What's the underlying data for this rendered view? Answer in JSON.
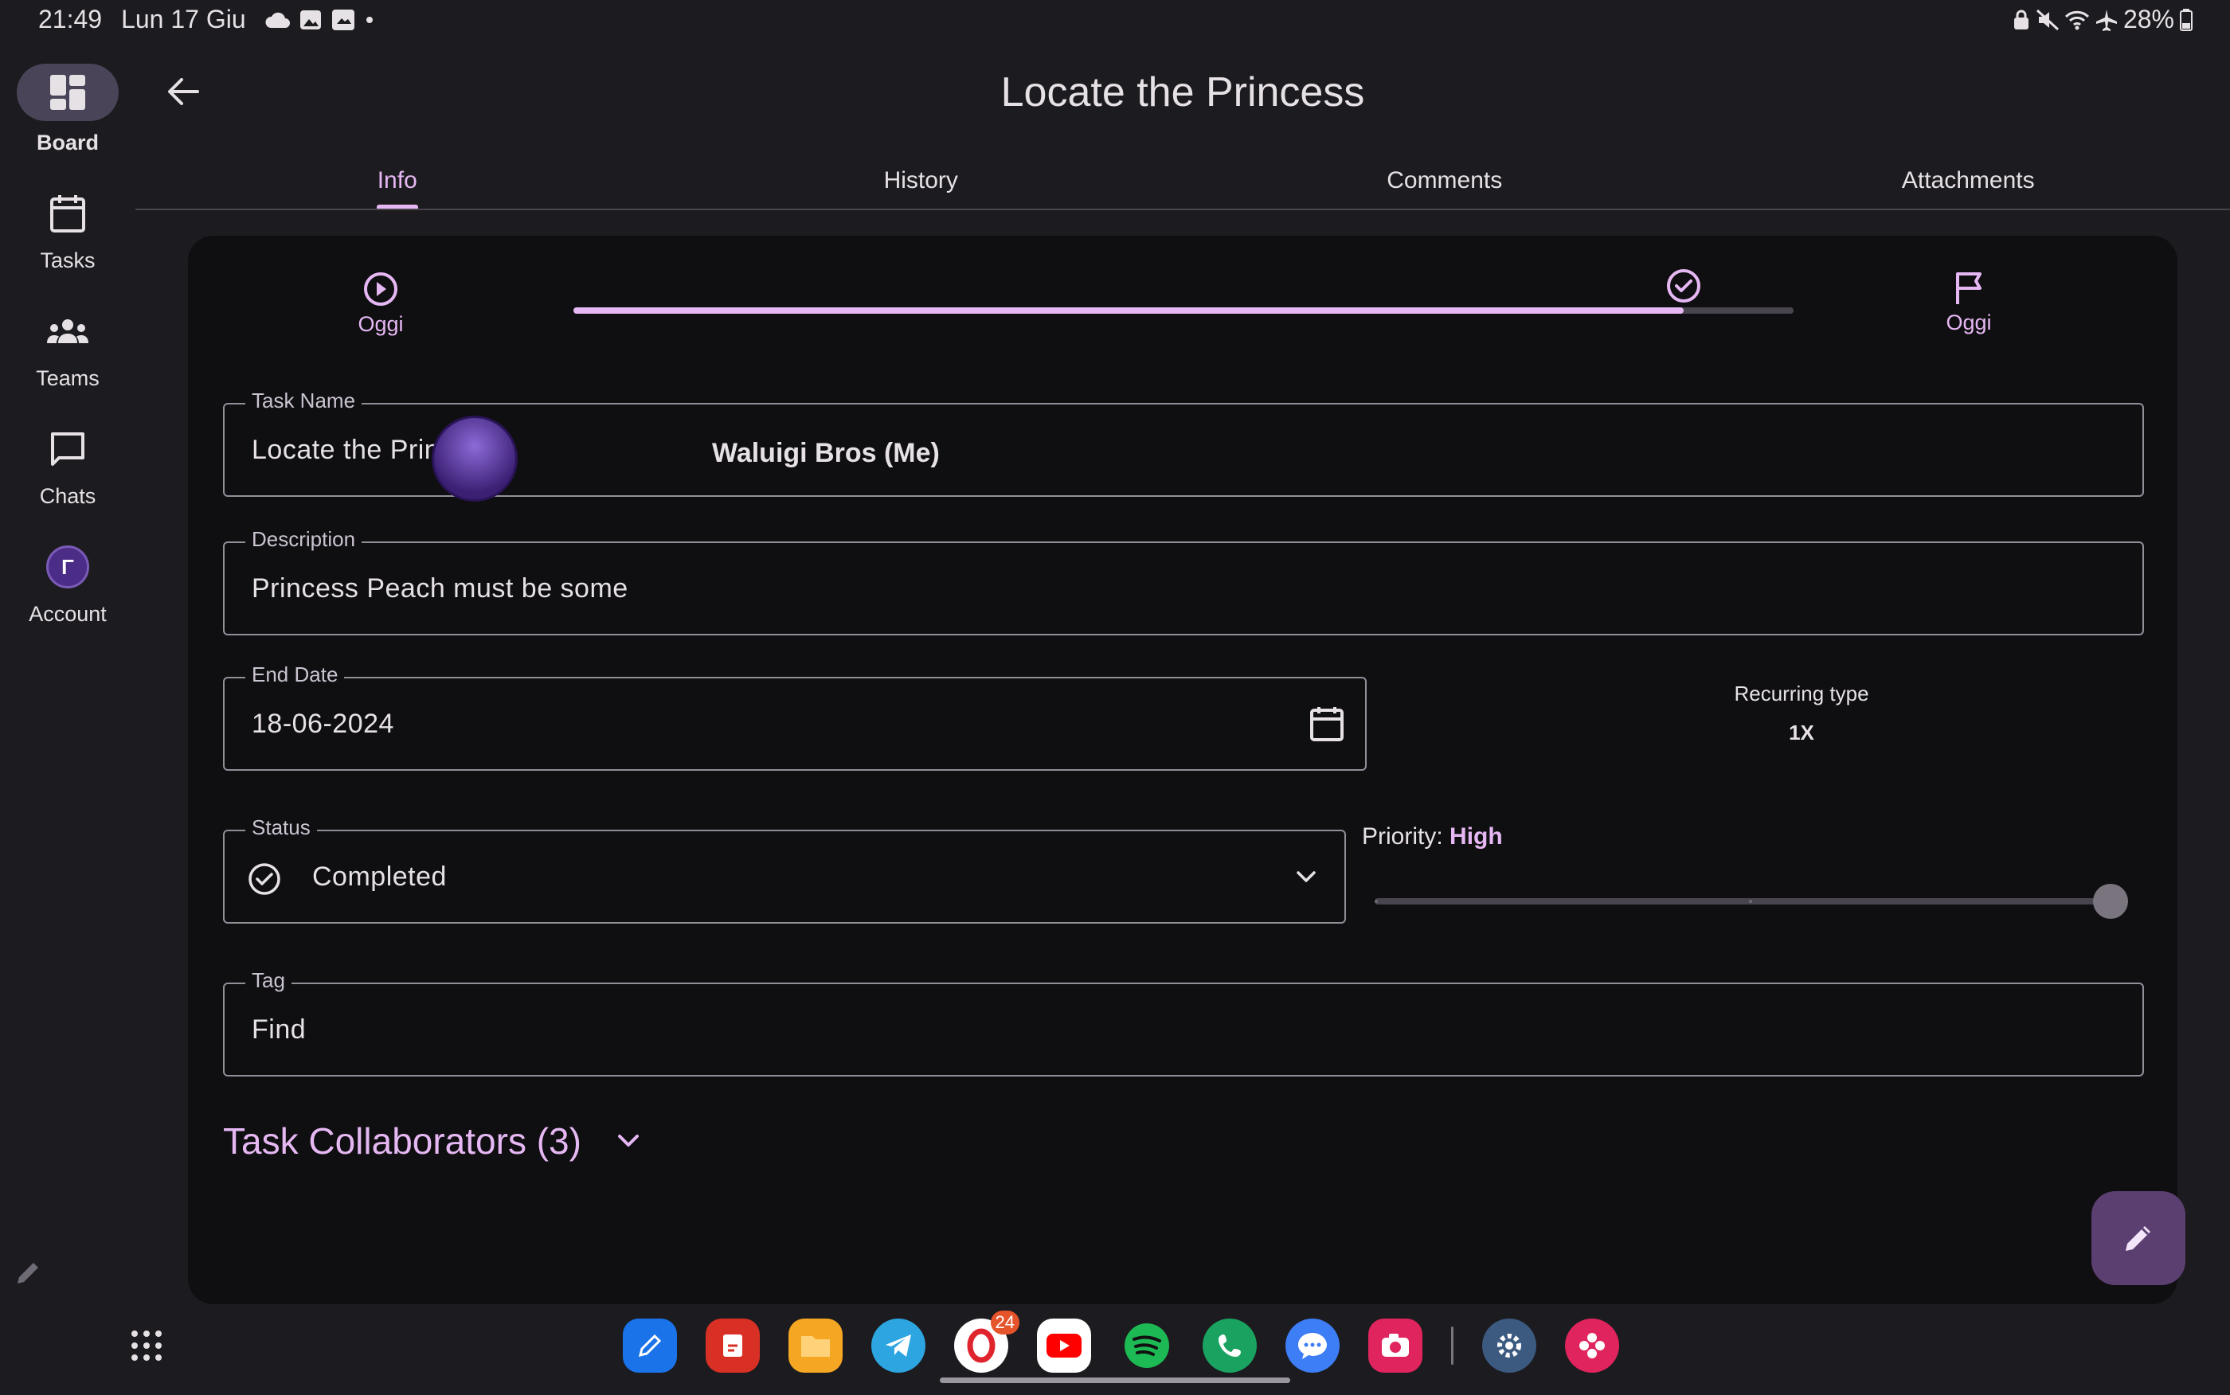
{
  "status_bar": {
    "time": "21:49",
    "date": "Lun 17 Giu",
    "battery": "28%",
    "left_icons": [
      "cloud-icon",
      "gallery-icon",
      "screenshot-icon",
      "dot-icon"
    ],
    "right_icons": [
      "lock-icon",
      "mute-icon",
      "wifi-icon",
      "airplane-icon",
      "battery-icon"
    ]
  },
  "rail": {
    "items": [
      {
        "label": "Board",
        "icon": "dashboard-icon",
        "active": true
      },
      {
        "label": "Tasks",
        "icon": "calendar-icon"
      },
      {
        "label": "Teams",
        "icon": "groups-icon"
      },
      {
        "label": "Chats",
        "icon": "chat-icon"
      },
      {
        "label": "Account",
        "icon": "avatar"
      }
    ]
  },
  "header": {
    "title": "Locate the Princess"
  },
  "tabs": [
    {
      "label": "Info",
      "active": true
    },
    {
      "label": "History"
    },
    {
      "label": "Comments"
    },
    {
      "label": "Attachments"
    }
  ],
  "progress": {
    "start_label": "Oggi",
    "end_label": "Oggi",
    "fraction": 0.91
  },
  "form": {
    "task_name": {
      "label": "Task Name",
      "value": "Locate the Princess"
    },
    "description": {
      "label": "Description",
      "value": "Princess Peach must be some"
    },
    "end_date": {
      "label": "End Date",
      "value": "18-06-2024"
    },
    "recurring": {
      "label": "Recurring type",
      "value": "1X"
    },
    "status": {
      "label": "Status",
      "value": "Completed"
    },
    "priority": {
      "label": "Priority:",
      "value": "High",
      "level": 1.0
    },
    "tag": {
      "label": "Tag",
      "value": "Find"
    }
  },
  "collaborators": {
    "title": "Task Collaborators (3)",
    "items": [
      {
        "name": "Waluigi Bros (Me)"
      }
    ]
  },
  "dock": {
    "apps": [
      {
        "name": "notes",
        "color": "#1a73e8"
      },
      {
        "name": "acrobat",
        "color": "#d93025"
      },
      {
        "name": "files",
        "color": "#f5a623"
      },
      {
        "name": "telegram",
        "color": "#2ca5e0"
      },
      {
        "name": "opera",
        "color": "#ffffff",
        "badge": "24"
      },
      {
        "name": "youtube",
        "color": "#ffffff"
      },
      {
        "name": "spotify",
        "color": "#1db954"
      },
      {
        "name": "phone",
        "color": "#1aa260"
      },
      {
        "name": "messages",
        "color": "#3d7df5"
      },
      {
        "name": "camera",
        "color": "#e0245e"
      },
      {
        "name": "settings",
        "color": "#3c5a80"
      },
      {
        "name": "flower",
        "color": "#e0245e"
      }
    ]
  }
}
